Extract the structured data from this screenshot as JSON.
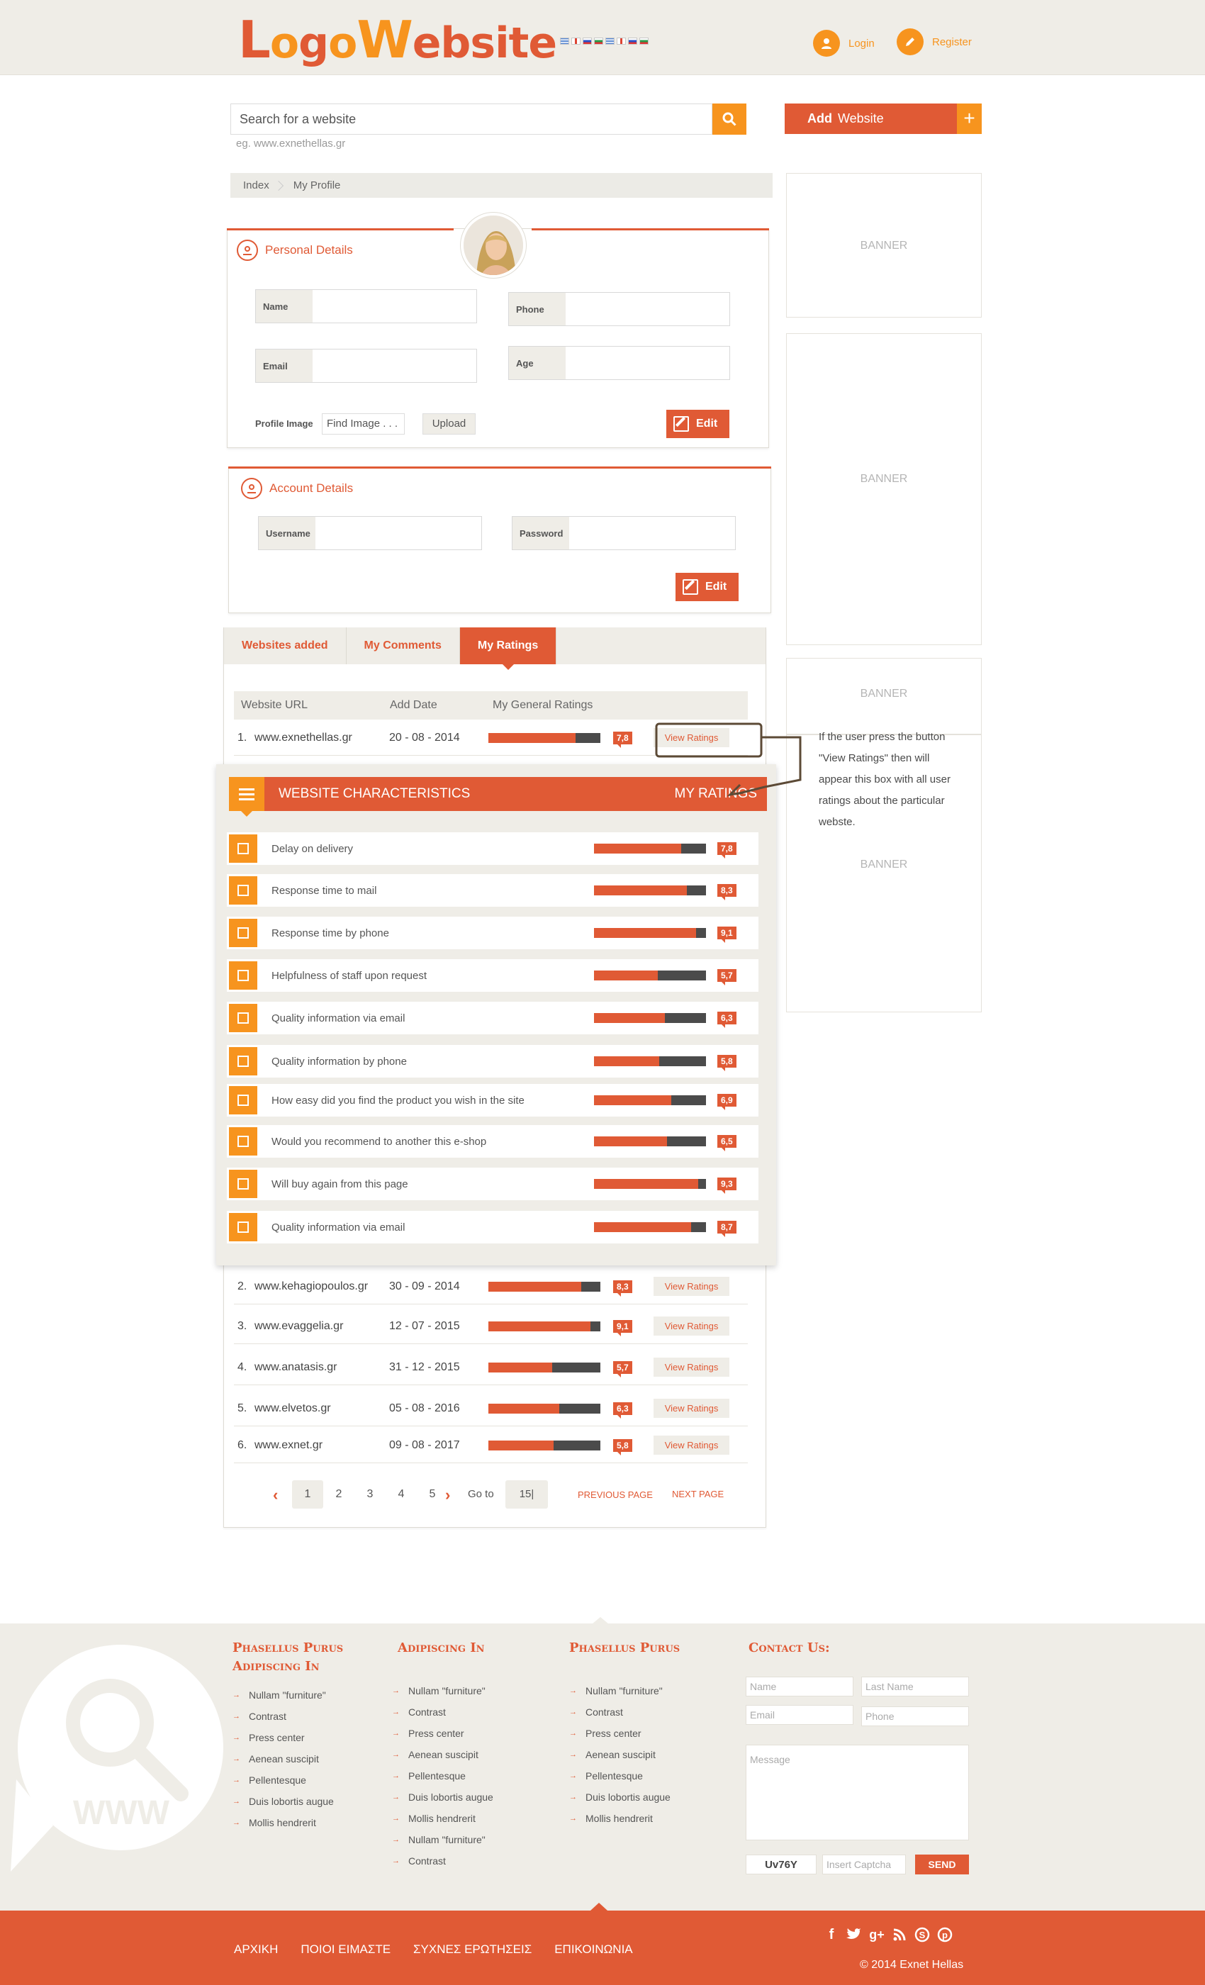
{
  "header": {
    "logo_first": "L",
    "logo_o": "o",
    "logo_g": "g",
    "logo_o2": "o",
    "logo_w": "W",
    "logo_rest": "ebsite",
    "login": "Login",
    "register": "Register"
  },
  "search": {
    "placeholder": "Search for a website",
    "hint": "eg. www.exnethellas.gr",
    "add_bold": "Add",
    "add_label": "Website",
    "add_plus": "+"
  },
  "breadcrumb": [
    "Index",
    "My Profile"
  ],
  "personal": {
    "title": "Personal Details",
    "name": "Name",
    "phone": "Phone",
    "email": "Email",
    "age": "Age",
    "profile_image": "Profile Image",
    "find_image": "Find Image . . .",
    "upload": "Upload",
    "edit": "Edit"
  },
  "account": {
    "title": "Account Details",
    "username": "Username",
    "password": "Password",
    "edit": "Edit"
  },
  "banners": [
    "BANNER",
    "BANNER",
    "BANNER",
    "BANNER"
  ],
  "tabs": [
    "Websites added",
    "My Comments",
    "My Ratings"
  ],
  "table": {
    "col_url": "Website URL",
    "col_date": "Add Date",
    "col_ratings": "My General Ratings",
    "view_label": "View Ratings",
    "rows": [
      {
        "num": "1.",
        "url": "www.exnethellas.gr",
        "date": "20 - 08 - 2014",
        "score": "7,8",
        "value": 0.78
      },
      {
        "num": "2.",
        "url": "www.kehagiopoulos.gr",
        "date": "30 - 09 - 2014",
        "score": "8,3",
        "value": 0.83
      },
      {
        "num": "3.",
        "url": "www.evaggelia.gr",
        "date": "12 - 07 - 2015",
        "score": "9,1",
        "value": 0.91
      },
      {
        "num": "4.",
        "url": "www.anatasis.gr",
        "date": "31 - 12 - 2015",
        "score": "5,7",
        "value": 0.57
      },
      {
        "num": "5.",
        "url": "www.elvetos.gr",
        "date": "05 - 08 - 2016",
        "score": "6,3",
        "value": 0.63
      },
      {
        "num": "6.",
        "url": "www.exnet.gr",
        "date": "09 - 08 - 2017",
        "score": "5,8",
        "value": 0.58
      }
    ]
  },
  "overlay": {
    "title": "WEBSITE CHARACTERISTICS",
    "right": "MY RATINGS",
    "items": [
      {
        "label": "Delay on delivery",
        "score": "7,8",
        "value": 0.78
      },
      {
        "label": "Response time to mail",
        "score": "8,3",
        "value": 0.83
      },
      {
        "label": "Response time by phone",
        "score": "9,1",
        "value": 0.91
      },
      {
        "label": "Helpfulness of staff upon request",
        "score": "5,7",
        "value": 0.57
      },
      {
        "label": "Quality information via email",
        "score": "6,3",
        "value": 0.63
      },
      {
        "label": "Quality information by phone",
        "score": "5,8",
        "value": 0.58
      },
      {
        "label": "How easy did you find the product you wish in the site",
        "score": "6,9",
        "value": 0.69
      },
      {
        "label": "Would you recommend to another this e-shop",
        "score": "6,5",
        "value": 0.65
      },
      {
        "label": "Will buy again from this page",
        "score": "9,3",
        "value": 0.93
      },
      {
        "label": "Quality information via email",
        "score": "8,7",
        "value": 0.87
      }
    ]
  },
  "callout": "If the user press the button \"View Ratings\" then will appear this box with all user ratings about the particular webste.",
  "pagination": {
    "pages": [
      "1",
      "2",
      "3",
      "4",
      "5"
    ],
    "goto": "Go to",
    "goto_value": "15|",
    "prev": "PREVIOUS PAGE",
    "next": "NEXT PAGE"
  },
  "footer": {
    "col1_title": "Phasellus Purus Adipiscing In",
    "col1": [
      "Nullam \"furniture\"",
      "Contrast",
      "Press center",
      "Aenean suscipit",
      "Pellentesque",
      "Duis lobortis augue",
      "Mollis hendrerit"
    ],
    "col2_title": "Adipiscing In",
    "col2": [
      "Nullam \"furniture\"",
      "Contrast",
      "Press center",
      "Aenean suscipit",
      "Pellentesque",
      "Duis lobortis augue",
      "Mollis hendrerit",
      "Nullam \"furniture\"",
      "Contrast"
    ],
    "col3_title": "Phasellus Purus",
    "col3": [
      "Nullam \"furniture\"",
      "Contrast",
      "Press center",
      "Aenean suscipit",
      "Pellentesque",
      "Duis lobortis augue",
      "Mollis hendrerit"
    ],
    "contact_title": "Contact Us:",
    "name": "Name",
    "last_name": "Last Name",
    "email": "Email",
    "phone": "Phone",
    "message": "Message",
    "captcha_code": "Uv76Y",
    "captcha_placeholder": "Insert Captcha",
    "send": "SEND",
    "www": "WWW"
  },
  "bottom": {
    "nav": [
      "ΑΡΧΙΚΗ",
      "ΠΟΙΟΙ ΕΙΜΑΣΤΕ",
      "ΣΥΧΝΕΣ ΕΡΩΤΗΣΕΙΣ",
      "ΕΠΙΚΟΙΝΩΝΙΑ"
    ],
    "copyright": "© 2014 Exnet Hellas"
  },
  "colors": {
    "accent": "#e05a35",
    "orange": "#f7941e",
    "bg": "#efede7",
    "bar_dark": "#4b4b4b"
  }
}
